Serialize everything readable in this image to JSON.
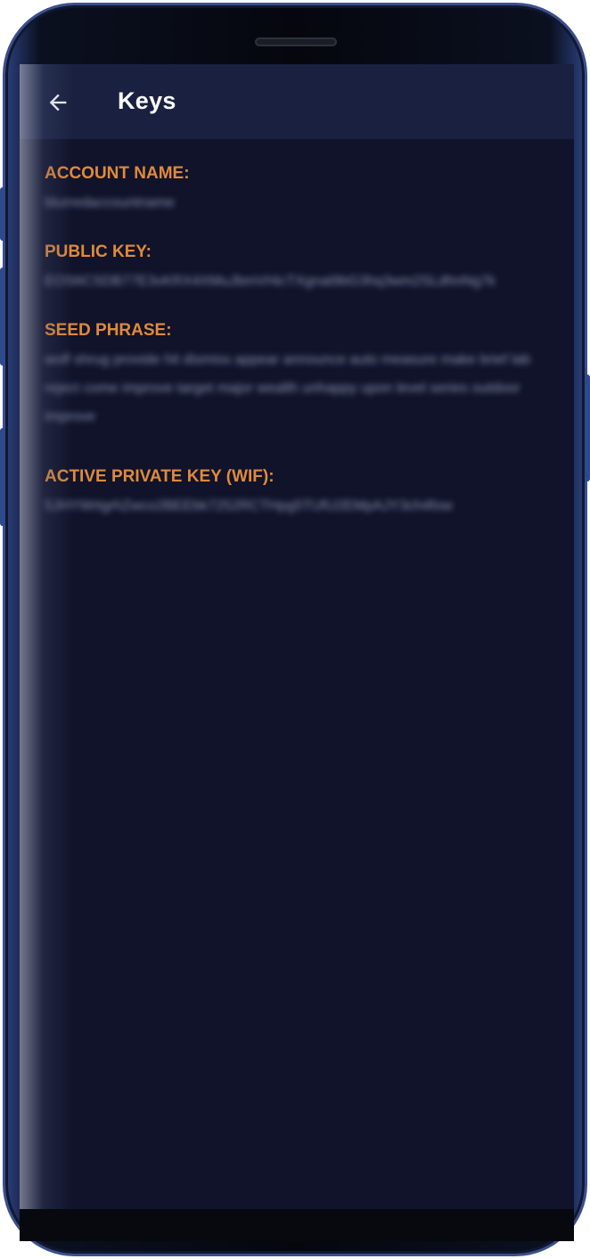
{
  "appbar": {
    "title": "Keys"
  },
  "icons": {
    "back": "arrow-left-icon"
  },
  "colors": {
    "label": "#e08a3c",
    "appbar_bg": "#1a2140",
    "screen_bg": "#10132a"
  },
  "fields": {
    "account_name": {
      "label": "ACCOUNT NAME:",
      "value": "blurredaccountname"
    },
    "public_key": {
      "label": "PUBLIC KEY:",
      "value": "EOS6CSDB77E3vKRX4XMuJbmVHicTXgnat9bG3hq3wm2SLdhnNg7k"
    },
    "seed_phrase": {
      "label": "SEED PHRASE:",
      "value": "wolf shrug provide hit dismiss appear announce auto measure make brief lab reject come improve target major wealth unhappy upon level series outdoor improve"
    },
    "active_private_key": {
      "label": "ACTIVE PRIVATE KEY (WIF):",
      "value": "5JHYWrtgrhZwco2BEEbk7252RCTHpg5TUfU2EMpAJY3ch4fow"
    }
  }
}
